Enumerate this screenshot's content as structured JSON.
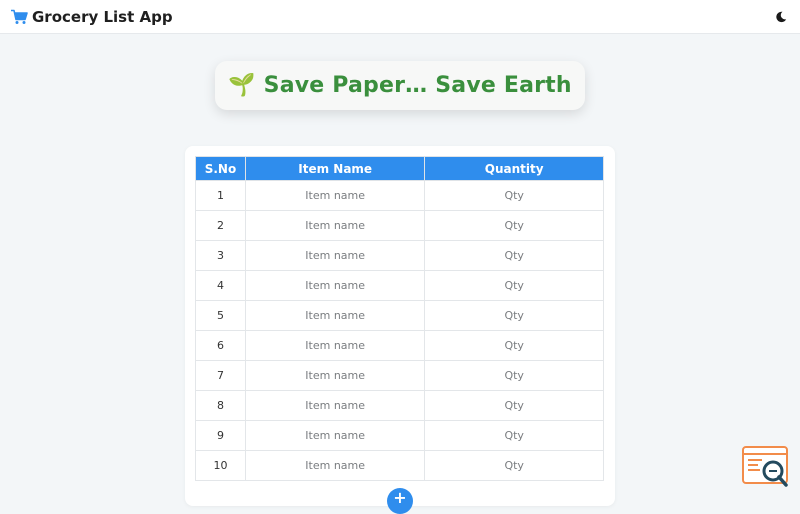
{
  "app": {
    "title": "Grocery List App"
  },
  "icons": {
    "cart": "shopping-cart-icon",
    "theme": "moon-icon",
    "banner": "leaf-icon",
    "widget": "search-inspect-icon"
  },
  "colors": {
    "accent": "#2f8ded",
    "banner_text": "#3a8f3d",
    "widget": "#f28c4a"
  },
  "banner": {
    "text": "🌱 Save Paper… Save Earth"
  },
  "table": {
    "headers": [
      "S.No",
      "Item Name",
      "Quantity"
    ],
    "rows": [
      {
        "sno": "1",
        "item_placeholder": "Item name",
        "qty_placeholder": "Qty"
      },
      {
        "sno": "2",
        "item_placeholder": "Item name",
        "qty_placeholder": "Qty"
      },
      {
        "sno": "3",
        "item_placeholder": "Item name",
        "qty_placeholder": "Qty"
      },
      {
        "sno": "4",
        "item_placeholder": "Item name",
        "qty_placeholder": "Qty"
      },
      {
        "sno": "5",
        "item_placeholder": "Item name",
        "qty_placeholder": "Qty"
      },
      {
        "sno": "6",
        "item_placeholder": "Item name",
        "qty_placeholder": "Qty"
      },
      {
        "sno": "7",
        "item_placeholder": "Item name",
        "qty_placeholder": "Qty"
      },
      {
        "sno": "8",
        "item_placeholder": "Item name",
        "qty_placeholder": "Qty"
      },
      {
        "sno": "9",
        "item_placeholder": "Item name",
        "qty_placeholder": "Qty"
      },
      {
        "sno": "10",
        "item_placeholder": "Item name",
        "qty_placeholder": "Qty"
      }
    ]
  },
  "add_button": {
    "label": "+"
  }
}
